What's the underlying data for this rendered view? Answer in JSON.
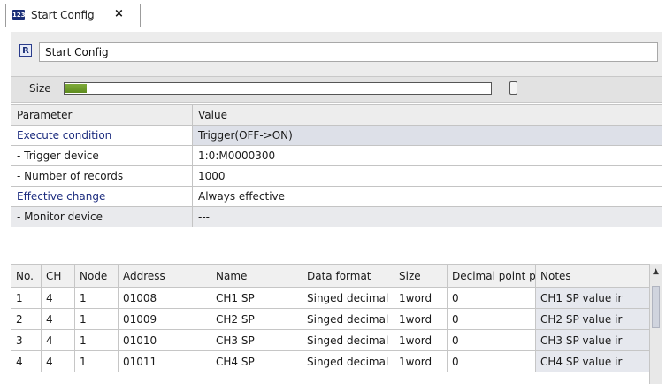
{
  "tab": {
    "icon": "123",
    "label": "Start Config",
    "close": "×"
  },
  "title": {
    "icon": "R",
    "value": "Start Config"
  },
  "size": {
    "label": "Size",
    "fill_fraction": 0.05
  },
  "params": {
    "header": {
      "param": "Parameter",
      "value": "Value"
    },
    "rows": [
      {
        "param": "Execute condition",
        "value": "Trigger(OFF->ON)"
      },
      {
        "param": "- Trigger device",
        "value": "1:0:M0000300"
      },
      {
        "param": "- Number of records",
        "value": "1000"
      },
      {
        "param": "Effective change",
        "value": "Always effective"
      },
      {
        "param": "- Monitor device",
        "value": "---"
      }
    ]
  },
  "grid": {
    "columns": [
      "No.",
      "CH",
      "Node",
      "Address",
      "Name",
      "Data format",
      "Size",
      "Decimal point pc",
      "Notes"
    ],
    "rows": [
      [
        "1",
        "4",
        "1",
        "01008",
        "CH1 SP",
        "Singed decimal",
        "1word",
        "0",
        "CH1 SP value ir"
      ],
      [
        "2",
        "4",
        "1",
        "01009",
        "CH2 SP",
        "Singed decimal",
        "1word",
        "0",
        "CH2 SP value ir"
      ],
      [
        "3",
        "4",
        "1",
        "01010",
        "CH3 SP",
        "Singed decimal",
        "1word",
        "0",
        "CH3 SP value ir"
      ],
      [
        "4",
        "4",
        "1",
        "01011",
        "CH4 SP",
        "Singed decimal",
        "1word",
        "0",
        "CH4 SP value ir"
      ]
    ]
  },
  "colors": {
    "link_blue": "#1c2c7f",
    "progress_green": "#6b9a28",
    "icon_navy": "#1b2f78"
  }
}
